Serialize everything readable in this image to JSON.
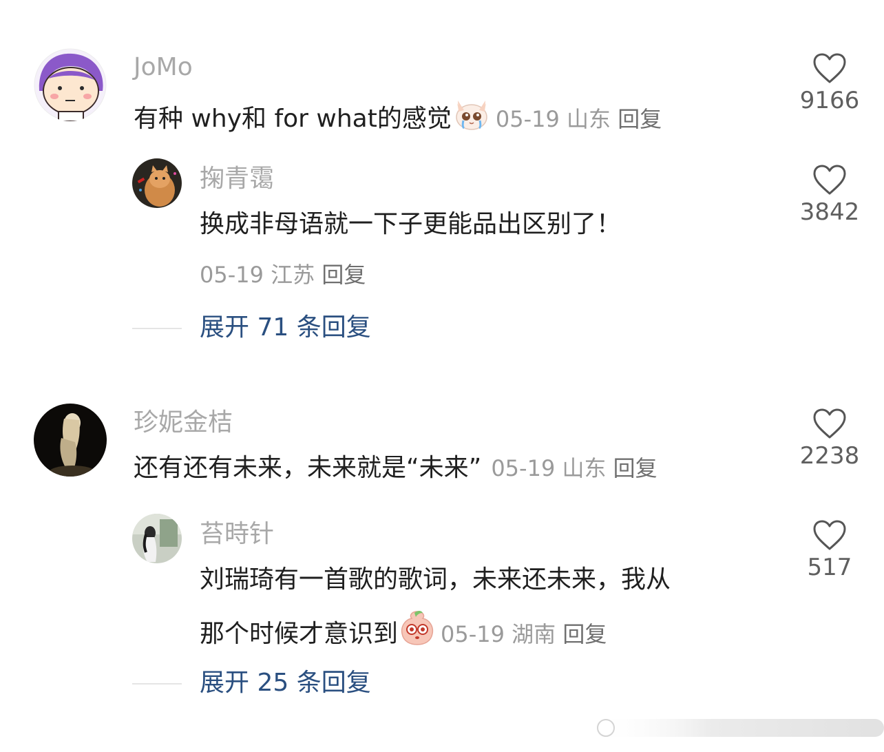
{
  "comments": [
    {
      "username": "JoMo",
      "text": "有种 why和 for what的感觉",
      "date": "05-19",
      "location": "山东",
      "reply_label": "回复",
      "likes": "9166",
      "reply": {
        "username": "掬青霭",
        "text": "换成非母语就一下子更能品出区别了！",
        "date": "05-19",
        "location": "江苏",
        "reply_label": "回复",
        "likes": "3842"
      },
      "expand_label": "展开 71 条回复"
    },
    {
      "username": "珍妮金桔",
      "text": "还有还有未来，未来就是“未来”",
      "date": "05-19",
      "location": "山东",
      "reply_label": "回复",
      "likes": "2238",
      "reply": {
        "username": "苔時针",
        "text_line1": "刘瑞琦有一首歌的歌词，未来还未来，我从",
        "text_line2": "那个时候才意识到",
        "date": "05-19",
        "location": "湖南",
        "reply_label": "回复",
        "likes": "517"
      },
      "expand_label": "展开 25 条回复"
    }
  ],
  "icons": {
    "like": "heart-outline-icon",
    "emoji1": "crying-cat-emoji",
    "emoji2": "peach-face-emoji"
  },
  "colors": {
    "username": "#a8a8a8",
    "text": "#1f1f1f",
    "meta": "#9a9a9a",
    "expand": "#2a4f80",
    "like_count": "#5f5f5f"
  }
}
